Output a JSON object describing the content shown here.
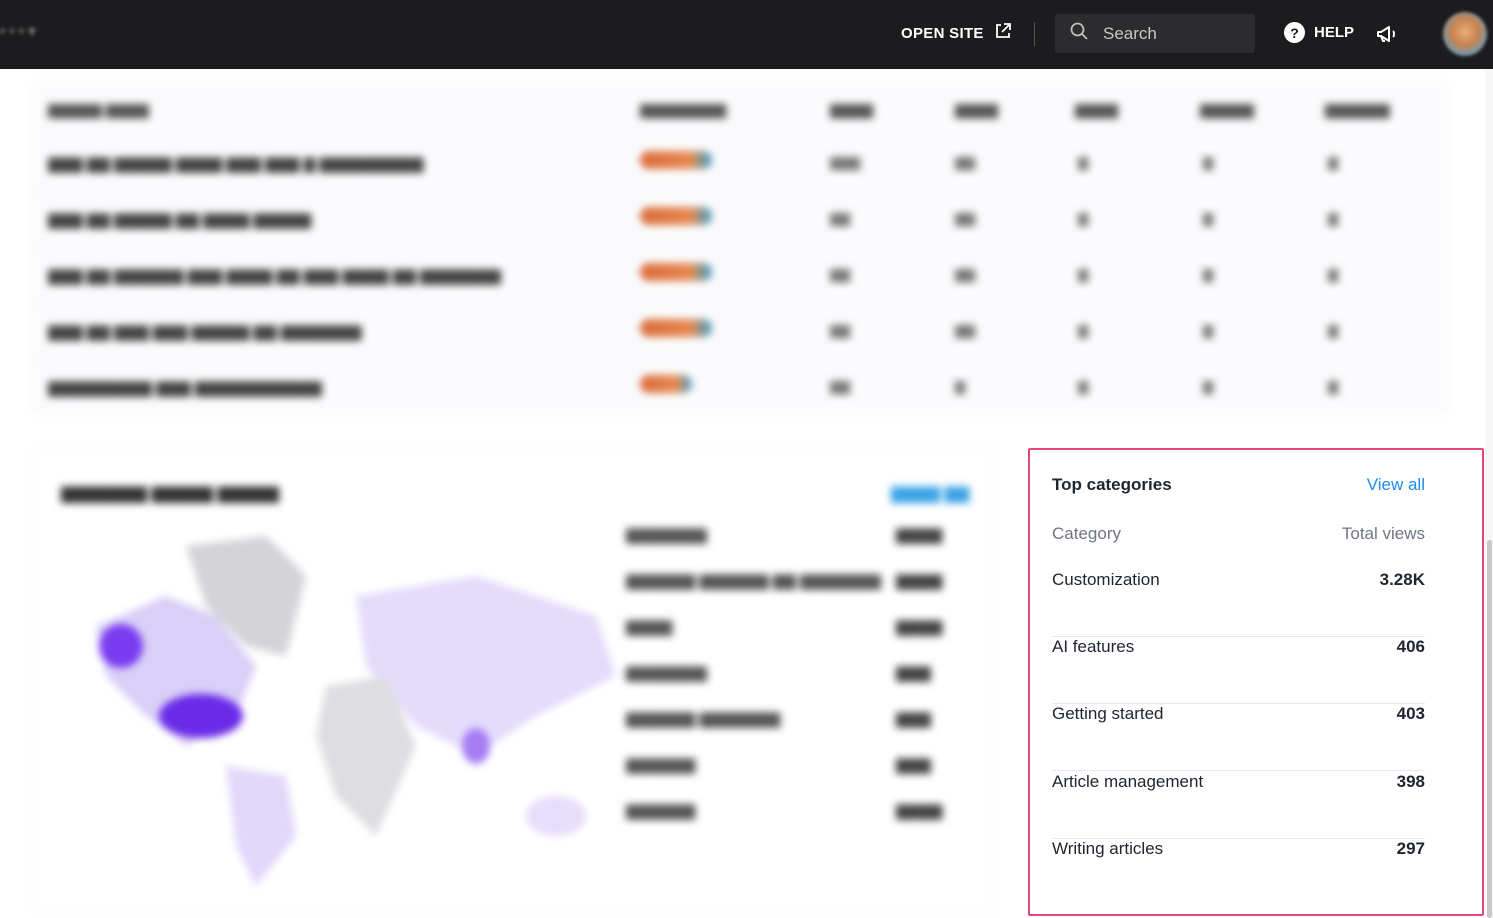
{
  "topbar": {
    "brand": "• • • ▾",
    "open_site": "OPEN SITE",
    "search_placeholder": "Search",
    "help": "HELP"
  },
  "top_categories": {
    "title": "Top categories",
    "view_all": "View all",
    "col_category": "Category",
    "col_views": "Total views",
    "rows": [
      {
        "name": "Customization",
        "views": "3.28K"
      },
      {
        "name": "AI features",
        "views": "406"
      },
      {
        "name": "Getting started",
        "views": "403"
      },
      {
        "name": "Article management",
        "views": "398"
      },
      {
        "name": "Writing articles",
        "views": "297"
      }
    ]
  },
  "colors": {
    "topbar_bg": "#1c1c1e",
    "highlight_border": "#e5467a",
    "link": "#1f8ceb"
  }
}
